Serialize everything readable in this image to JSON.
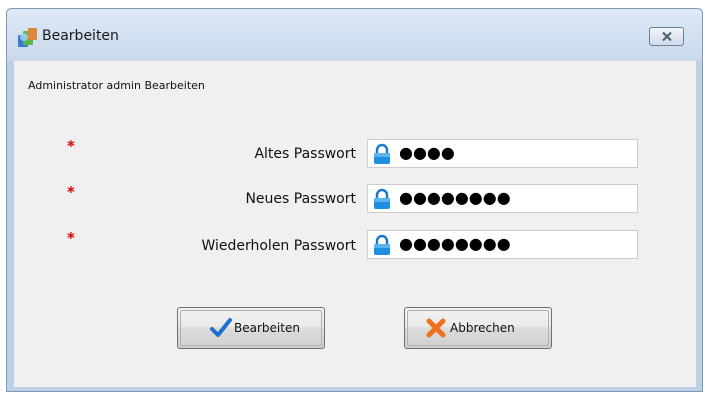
{
  "window": {
    "title": "Bearbeiten",
    "close_icon": "close-icon"
  },
  "form": {
    "subtitle": "Administrator admin Bearbeiten",
    "required_marker": "*",
    "fields": [
      {
        "label": "Altes Passwort",
        "value": "●●●●",
        "icon": "lock-icon"
      },
      {
        "label": "Neues Passwort",
        "value": "●●●●●●●●",
        "icon": "lock-icon"
      },
      {
        "label": "Wiederholen Passwort",
        "value": "●●●●●●●●",
        "icon": "lock-icon"
      }
    ]
  },
  "buttons": {
    "save_label": "Bearbeiten",
    "save_icon": "checkmark-icon",
    "cancel_label": "Abbrechen",
    "cancel_icon": "x-icon"
  },
  "colors": {
    "required": "#e00000",
    "check": "#1e6fd0",
    "cancel": "#f07020",
    "lock": "#1f8fe0"
  }
}
